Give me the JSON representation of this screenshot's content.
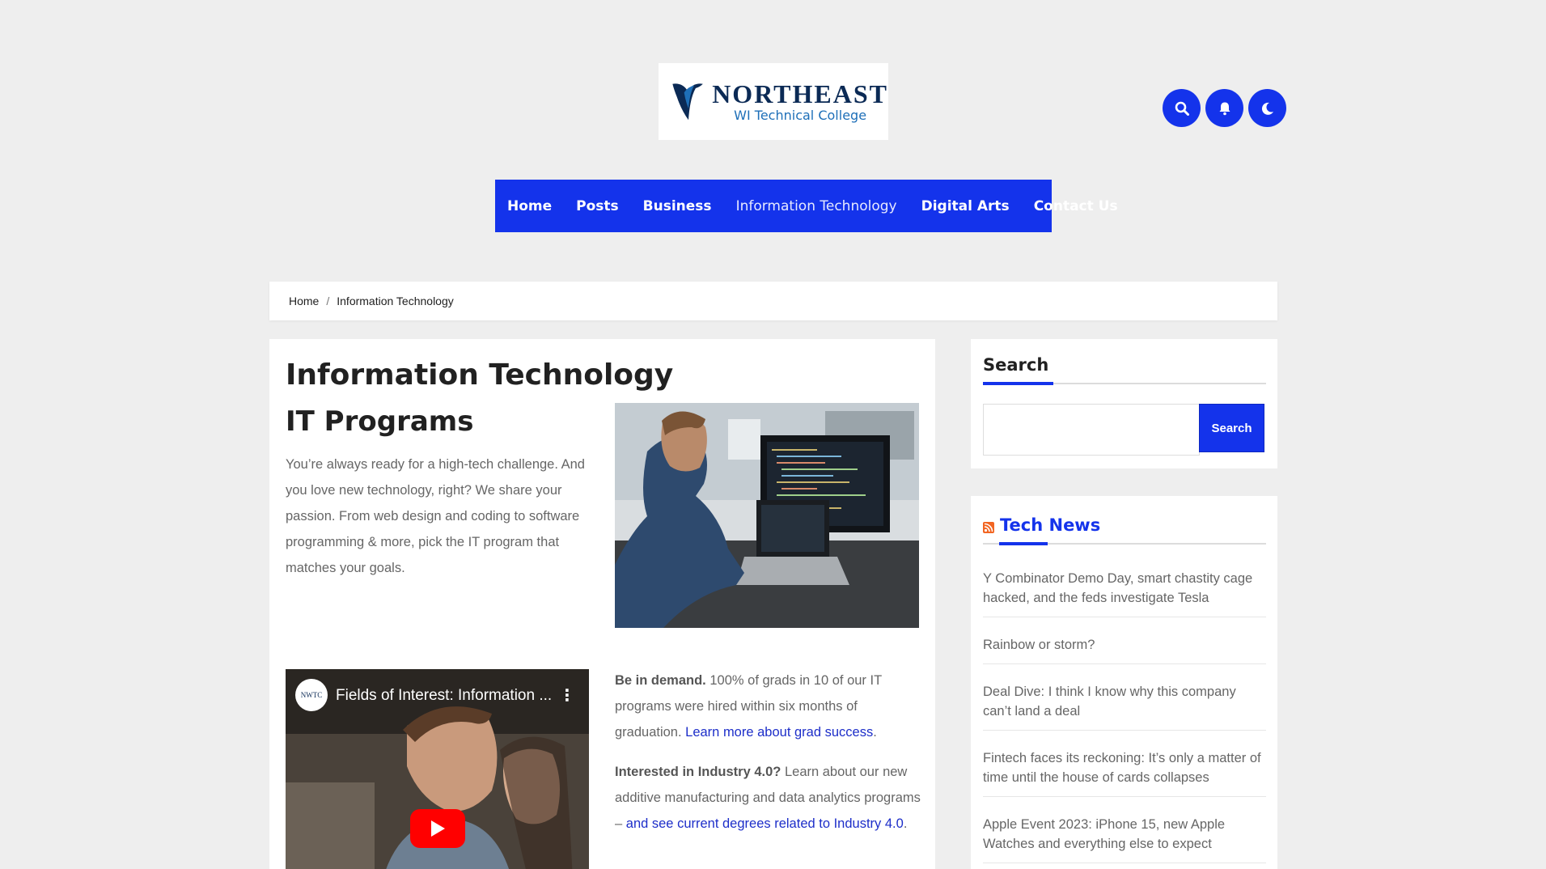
{
  "logo": {
    "line1": "NORTHEAST",
    "line2": "WI Technical College"
  },
  "header_buttons": [
    {
      "icon": "search-icon"
    },
    {
      "icon": "bell-icon"
    },
    {
      "icon": "moon-icon"
    }
  ],
  "nav": {
    "items": [
      "Home",
      "Posts",
      "Business",
      "Information Technology",
      "Digital Arts",
      "Contact Us"
    ]
  },
  "breadcrumb": {
    "home": "Home",
    "separator": "/",
    "current": "Information Technology"
  },
  "main": {
    "title": "Information Technology",
    "subtitle": "IT Programs",
    "intro": "You’re always ready for a high-tech challenge. And you love new technology, right? We share your passion. From web design and coding to software programming & more, pick the IT program that matches your goals.",
    "video": {
      "title": "Fields of Interest: Information ...",
      "channel_logo": "NWTC"
    },
    "p1_bold": "Be in demand.",
    "p1_text": " 100% of grads in 10 of our IT programs were hired within six months of graduation. ",
    "p1_link": "Learn more about grad success",
    "p1_end": ".",
    "p2_bold": "Interested in Industry 4.0?",
    "p2_text": " Learn about our new additive manufacturing and data analytics programs – ",
    "p2_link": "and see current degrees related to Industry 4.0",
    "p2_end": "."
  },
  "sidebar": {
    "search_title": "Search",
    "search_button": "Search",
    "news_title": "Tech News",
    "news": [
      "Y Combinator Demo Day, smart chastity cage hacked, and the feds investigate Tesla",
      "Rainbow or storm?",
      "Deal Dive: I think I know why this company can’t land a deal",
      "Fintech faces its reckoning: It’s only a matter of time until the house of cards collapses",
      "Apple Event 2023: iPhone 15, new Apple Watches and everything else to expect"
    ]
  },
  "colors": {
    "accent": "#1433eb",
    "background": "#eeeeee",
    "link": "#1d2ec9"
  }
}
